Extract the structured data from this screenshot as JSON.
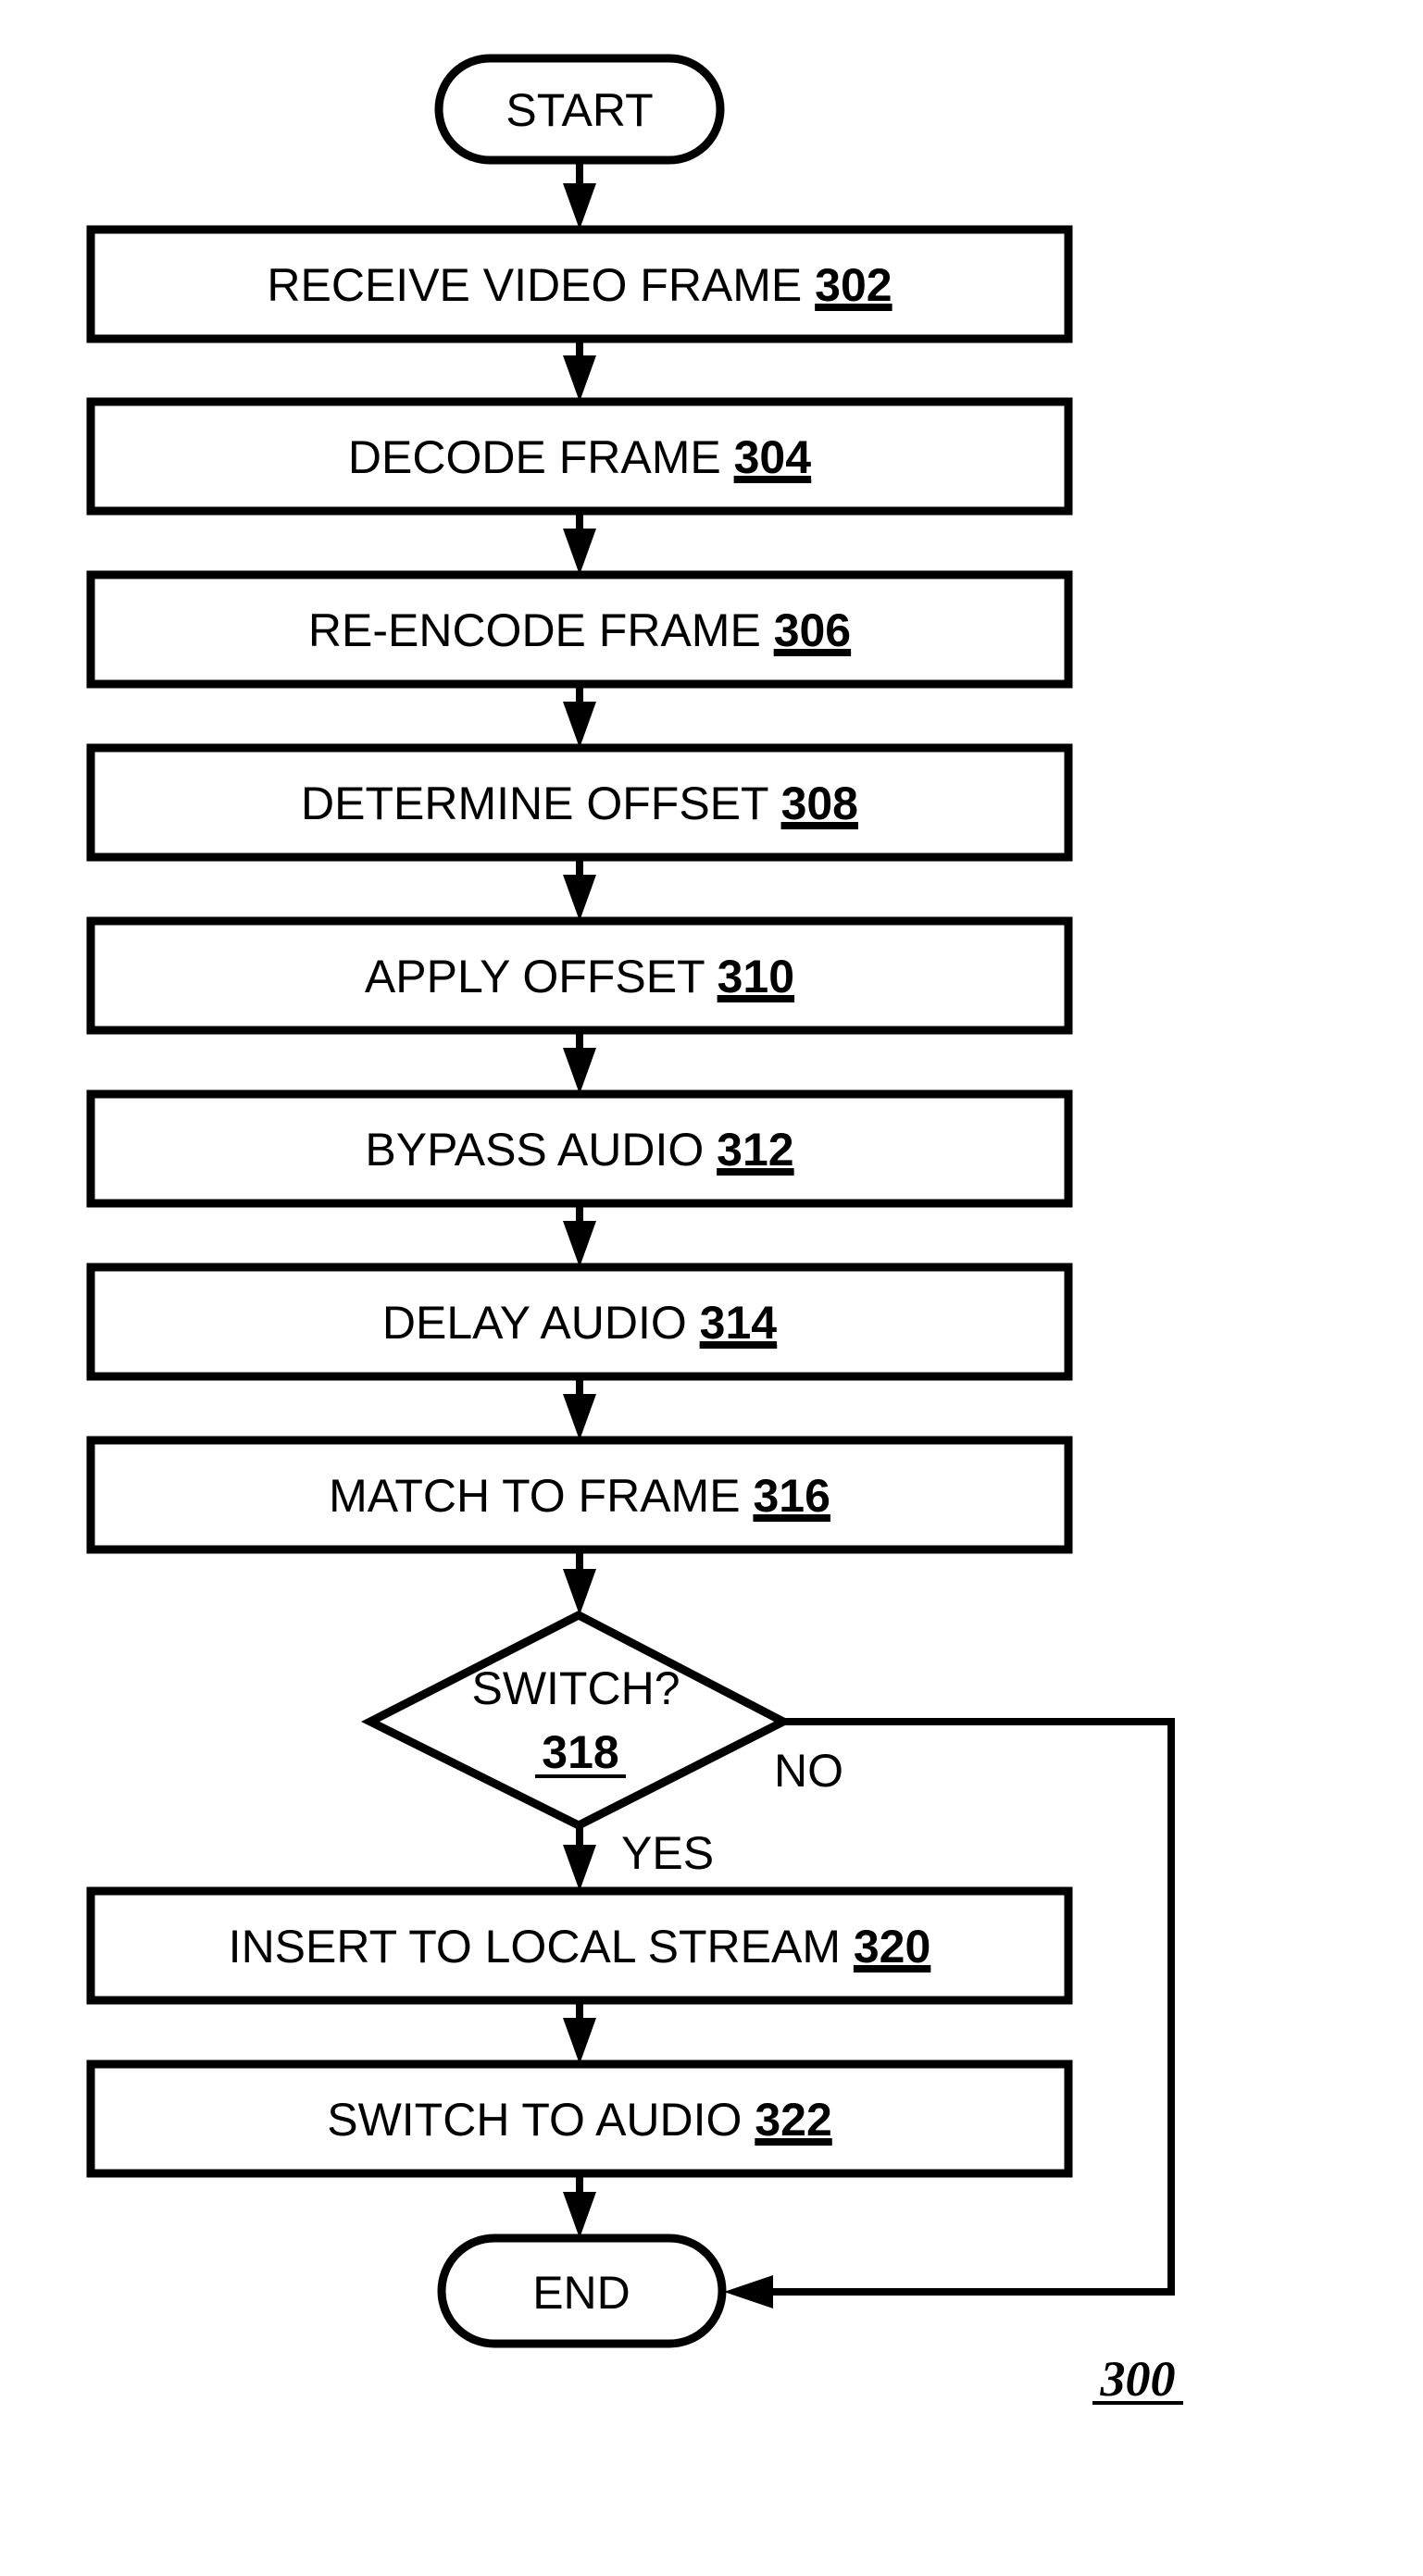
{
  "figure": {
    "reference_label": "300",
    "colors": {
      "stroke": "#000000",
      "background": "#ffffff"
    }
  },
  "terminals": {
    "start": {
      "label": "START"
    },
    "end": {
      "label": "END"
    }
  },
  "steps": [
    {
      "id": "302",
      "text": "RECEIVE VIDEO FRAME",
      "ref": "302"
    },
    {
      "id": "304",
      "text": "DECODE FRAME",
      "ref": "304"
    },
    {
      "id": "306",
      "text": "RE-ENCODE FRAME",
      "ref": "306"
    },
    {
      "id": "308",
      "text": "DETERMINE OFFSET",
      "ref": "308"
    },
    {
      "id": "310",
      "text": "APPLY OFFSET",
      "ref": "310"
    },
    {
      "id": "312",
      "text": "BYPASS AUDIO",
      "ref": "312"
    },
    {
      "id": "314",
      "text": "DELAY AUDIO",
      "ref": "314"
    },
    {
      "id": "316",
      "text": "MATCH TO FRAME",
      "ref": "316"
    },
    {
      "id": "320",
      "text": "INSERT TO LOCAL STREAM",
      "ref": "320"
    },
    {
      "id": "322",
      "text": "SWITCH TO AUDIO",
      "ref": "322"
    }
  ],
  "decision": {
    "id": "318",
    "question": "SWITCH?",
    "ref": "318",
    "yes_label": "YES",
    "no_label": "NO"
  },
  "edges": [
    {
      "from": "start",
      "to": "302"
    },
    {
      "from": "302",
      "to": "304"
    },
    {
      "from": "304",
      "to": "306"
    },
    {
      "from": "306",
      "to": "308"
    },
    {
      "from": "308",
      "to": "310"
    },
    {
      "from": "310",
      "to": "312"
    },
    {
      "from": "312",
      "to": "314"
    },
    {
      "from": "314",
      "to": "316"
    },
    {
      "from": "316",
      "to": "318"
    },
    {
      "from": "318",
      "to": "320",
      "label": "YES"
    },
    {
      "from": "318",
      "to": "end",
      "label": "NO"
    },
    {
      "from": "320",
      "to": "322"
    },
    {
      "from": "322",
      "to": "end"
    }
  ]
}
